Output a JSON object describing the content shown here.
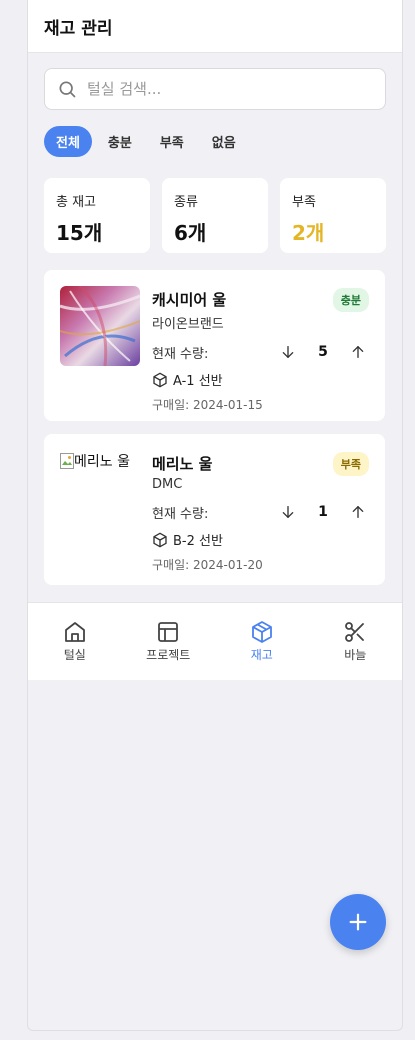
{
  "header": {
    "title": "재고 관리"
  },
  "search": {
    "placeholder": "털실 검색..."
  },
  "filters": [
    "전체",
    "충분",
    "부족",
    "없음"
  ],
  "stats": [
    {
      "label": "총 재고",
      "value": "15개"
    },
    {
      "label": "종류",
      "value": "6개"
    },
    {
      "label": "부족",
      "value": "2개"
    }
  ],
  "items": [
    {
      "name": "캐시미어 울",
      "brand": "라이온브랜드",
      "badge": "충분",
      "qty_label": "현재 수량:",
      "qty": "5",
      "location": "A-1 선반",
      "date": "구매일: 2024-01-15"
    },
    {
      "name": "메리노 울",
      "image_alt": "메리노 울",
      "brand": "DMC",
      "badge": "부족",
      "qty_label": "현재 수량:",
      "qty": "1",
      "location": "B-2 선반",
      "date": "구매일: 2024-01-20"
    }
  ],
  "nav": [
    {
      "label": "털실",
      "icon": "home-icon"
    },
    {
      "label": "프로젝트",
      "icon": "layout-icon"
    },
    {
      "label": "재고",
      "icon": "package-icon",
      "active": true
    },
    {
      "label": "바늘",
      "icon": "scissors-icon"
    }
  ],
  "colors": {
    "accent": "#4a82f0",
    "warning": "#e4b526"
  }
}
